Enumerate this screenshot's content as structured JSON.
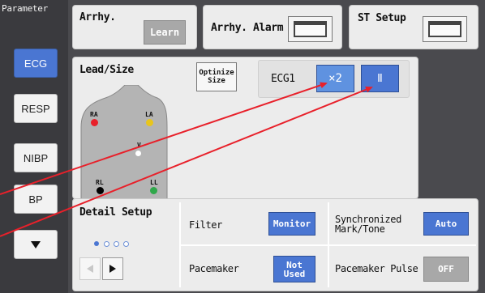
{
  "sidebar": {
    "title": "Parameter",
    "items": [
      {
        "label": "ECG",
        "active": true
      },
      {
        "label": "RESP"
      },
      {
        "label": "NIBP"
      },
      {
        "label": "BP"
      }
    ],
    "more_icon": "down-triangle-icon"
  },
  "top": {
    "arrhy": {
      "title": "Arrhy.",
      "learn_label": "Learn"
    },
    "arrhy_alarm": {
      "title": "Arrhy. Alarm",
      "icon": "window-icon"
    },
    "st_setup": {
      "title": "ST Setup",
      "icon": "window-icon"
    }
  },
  "lead_size": {
    "title": "Lead/Size",
    "optimize_label": "Optinize Size",
    "channel_label": "ECG1",
    "size_value": "×2",
    "lead_value": "Ⅱ",
    "electrodes": [
      {
        "label": "RA",
        "color": "#e8202a"
      },
      {
        "label": "LA",
        "color": "#e8c51c"
      },
      {
        "label": "V",
        "color": "#ffffff"
      },
      {
        "label": "RL",
        "color": "#000000"
      },
      {
        "label": "LL",
        "color": "#2fa84a"
      }
    ]
  },
  "detail": {
    "title": "Detail Setup",
    "filter_label": "Filter",
    "filter_value": "Monitor",
    "sync_label": "Synchronized Mark/Tone",
    "sync_value": "Auto",
    "pacemaker_label": "Pacemaker",
    "pacemaker_value": "Not Used",
    "pacemaker_pulse_label": "Pacemaker Pulse",
    "pacemaker_pulse_value": "OFF",
    "prev_icon": "left-arrow-icon",
    "next_icon": "right-arrow-icon"
  },
  "colors": {
    "accent": "#4a76d2",
    "annotation_arrow": "#e8202a"
  }
}
